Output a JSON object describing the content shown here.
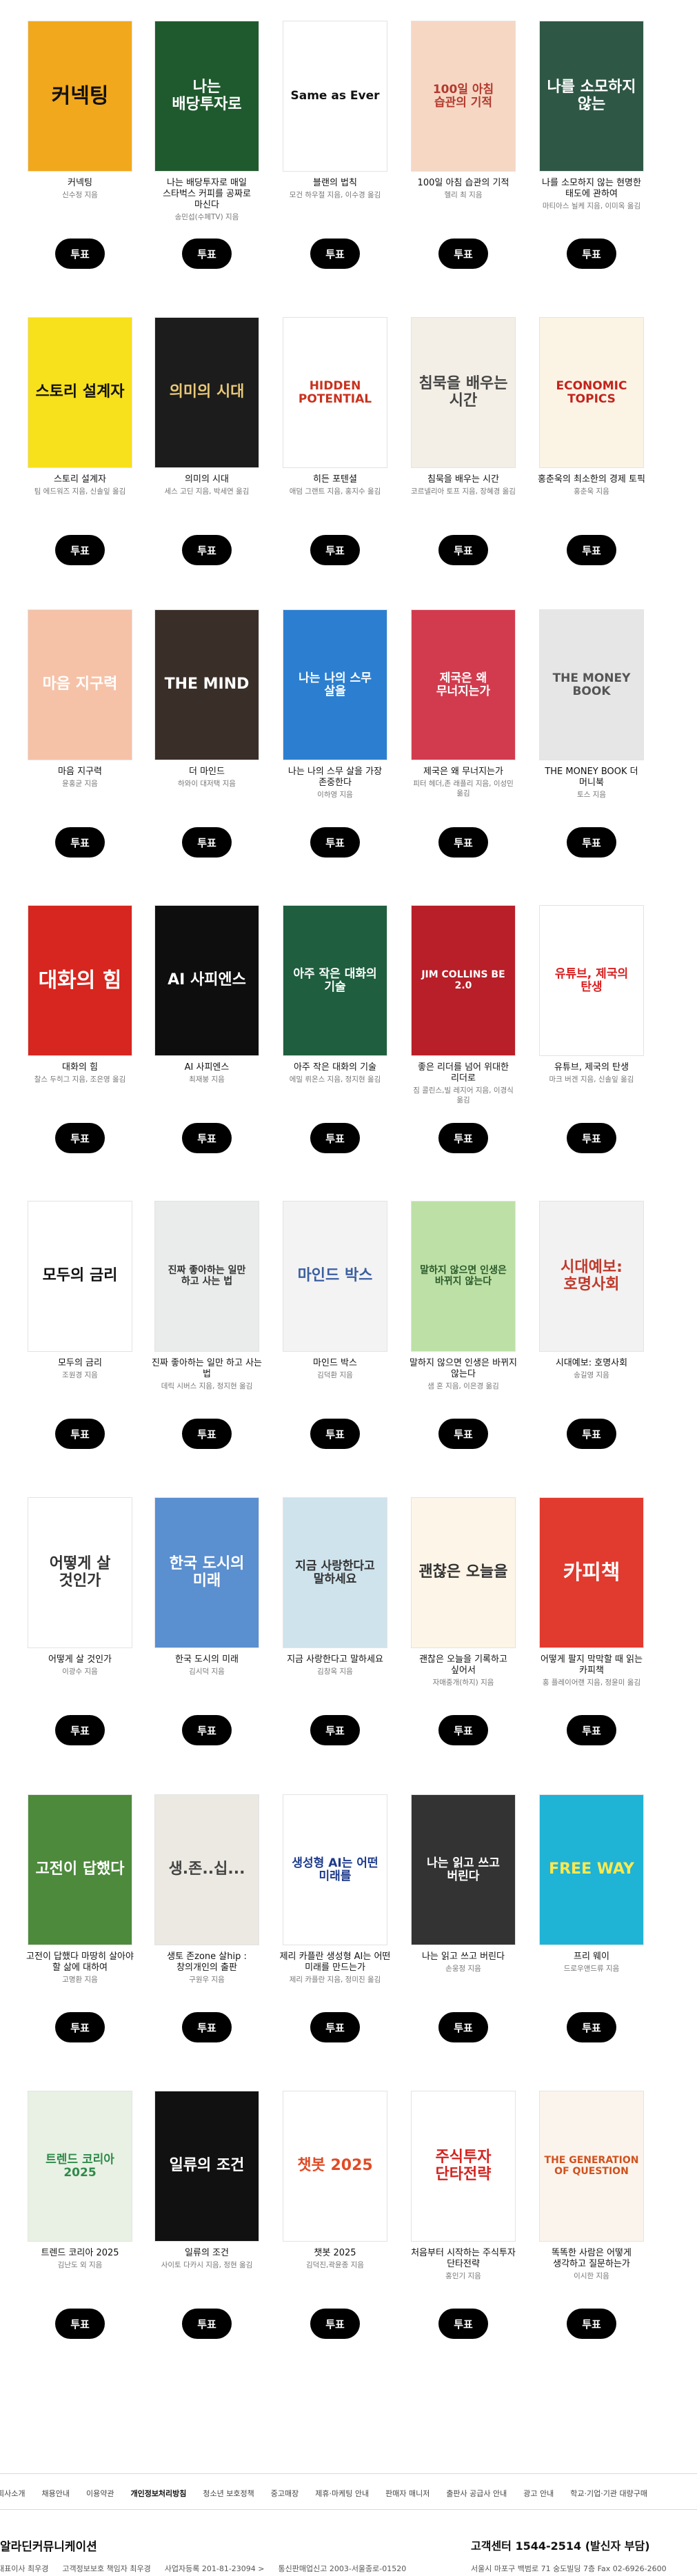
{
  "vote_label": "투표",
  "books": [
    {
      "title": "커넥팅",
      "author": "신수정 지음",
      "cover_bg": "#f2a81c",
      "cover_fg": "#111111",
      "cover_text": "커넥팅"
    },
    {
      "title": "나는 배당투자로 매일 스타벅스 커피를 공짜로 마신다",
      "author": "송민섭(수페TV) 지음",
      "cover_bg": "#1f5a2e",
      "cover_fg": "#ffffff",
      "cover_text": "나는 배당투자로"
    },
    {
      "title": "블랜의 법칙",
      "author": "모건 하우절 지음, 이수경 옮김",
      "cover_bg": "#ffffff",
      "cover_fg": "#111111",
      "cover_text": "Same as Ever"
    },
    {
      "title": "100일 아침 습관의 기적",
      "author": "헬리 최 지음",
      "cover_bg": "#f6d7c4",
      "cover_fg": "#b23a2e",
      "cover_text": "100일 아침 습관의 기적"
    },
    {
      "title": "나를 소모하지 않는 현명한 태도에 관하여",
      "author": "마티아스 뇔케 지음, 이미옥 옮김",
      "cover_bg": "#2f5746",
      "cover_fg": "#ffffff",
      "cover_text": "나를 소모하지 않는"
    },
    {
      "title": "스토리 설계자",
      "author": "팀 에드워즈 지음, 신솔잎 옮김",
      "cover_bg": "#f7e01c",
      "cover_fg": "#111111",
      "cover_text": "스토리 설계자"
    },
    {
      "title": "의미의 시대",
      "author": "세스 고딘 지음, 박세연 옮김",
      "cover_bg": "#1c1c1c",
      "cover_fg": "#e8c777",
      "cover_text": "의미의 시대"
    },
    {
      "title": "히든 포텐셜",
      "author": "애덤 그랜트 지음, 홍지수 옮김",
      "cover_bg": "#ffffff",
      "cover_fg": "#c8321e",
      "cover_text": "HIDDEN POTENTIAL"
    },
    {
      "title": "침묵을 배우는 시간",
      "author": "코르넬리아 토프 지음, 장혜경 옮김",
      "cover_bg": "#f3efe6",
      "cover_fg": "#444444",
      "cover_text": "침묵을 배우는 시간"
    },
    {
      "title": "홍춘욱의 최소한의 경제 토픽",
      "author": "홍춘욱 지음",
      "cover_bg": "#fbf4e5",
      "cover_fg": "#c3231d",
      "cover_text": "ECONOMIC TOPICS"
    },
    {
      "title": "마음 지구력",
      "author": "윤홍균 지음",
      "cover_bg": "#f5c2a8",
      "cover_fg": "#ffffff",
      "cover_text": "마음 지구력"
    },
    {
      "title": "더 마인드",
      "author": "하와이 대저택 지음",
      "cover_bg": "#3a2e28",
      "cover_fg": "#ffffff",
      "cover_text": "THE MIND"
    },
    {
      "title": "나는 나의 스무 살을 가장 존중한다",
      "author": "이하영 지음",
      "cover_bg": "#2c7fd0",
      "cover_fg": "#ffffff",
      "cover_text": "나는 나의 스무 살을"
    },
    {
      "title": "제국은 왜 무너지는가",
      "author": "피터 헤더,존 래플리 지음, 이성민 옮김",
      "cover_bg": "#d23b4e",
      "cover_fg": "#ffffff",
      "cover_text": "제국은 왜 무너지는가"
    },
    {
      "title": "THE MONEY BOOK 더 머니북",
      "author": "토스 지음",
      "cover_bg": "#e6e6e6",
      "cover_fg": "#555555",
      "cover_text": "THE MONEY BOOK"
    },
    {
      "title": "대화의 힘",
      "author": "찰스 두히그 지음, 조은영 옮김",
      "cover_bg": "#d6261f",
      "cover_fg": "#ffffff",
      "cover_text": "대화의 힘"
    },
    {
      "title": "AI 사피엔스",
      "author": "최재붕 지음",
      "cover_bg": "#0e0e0e",
      "cover_fg": "#ffffff",
      "cover_text": "AI 사피엔스"
    },
    {
      "title": "아주 작은 대화의 기술",
      "author": "에밀 뤼온스 지음, 정지현 옮김",
      "cover_bg": "#1f5e3e",
      "cover_fg": "#ffffff",
      "cover_text": "아주 작은 대화의 기술"
    },
    {
      "title": "좋은 리더를 넘어 위대한 리더로",
      "author": "짐 콜린스,빌 레지어 지음, 이경식 옮김",
      "cover_bg": "#b81f28",
      "cover_fg": "#ffffff",
      "cover_text": "JIM COLLINS BE 2.0"
    },
    {
      "title": "유튜브, 제국의 탄생",
      "author": "마크 버겐 지음, 신솔잎 옮김",
      "cover_bg": "#ffffff",
      "cover_fg": "#d81f1f",
      "cover_text": "유튜브, 제국의 탄생"
    },
    {
      "title": "모두의 금리",
      "author": "조원경 지음",
      "cover_bg": "#ffffff",
      "cover_fg": "#111111",
      "cover_text": "모두의 금리"
    },
    {
      "title": "진짜 좋아하는 일만 하고 사는 법",
      "author": "데릭 시버스 지음, 정지현 옮김",
      "cover_bg": "#e9ecea",
      "cover_fg": "#333333",
      "cover_text": "진짜 좋아하는 일만 하고 사는 법"
    },
    {
      "title": "마인드 박스",
      "author": "김덕환 지음",
      "cover_bg": "#f3f3f3",
      "cover_fg": "#3b5fa0",
      "cover_text": "마인드 박스"
    },
    {
      "title": "말하지 않으면 인생은 바뀌지 않는다",
      "author": "샘 혼 지음, 이은경 옮김",
      "cover_bg": "#bde0a6",
      "cover_fg": "#2a5a2a",
      "cover_text": "말하지 않으면 인생은 바뀌지 않는다"
    },
    {
      "title": "시대예보: 호명사회",
      "author": "송길영 지음",
      "cover_bg": "#f2f2f2",
      "cover_fg": "#c0392b",
      "cover_text": "시대예보: 호명사회"
    },
    {
      "title": "어떻게 살 것인가",
      "author": "이광수 지음",
      "cover_bg": "#ffffff",
      "cover_fg": "#333333",
      "cover_text": "어떻게 살 것인가"
    },
    {
      "title": "한국 도시의 미래",
      "author": "김시덕 지음",
      "cover_bg": "#5a8fd0",
      "cover_fg": "#ffffff",
      "cover_text": "한국 도시의 미래"
    },
    {
      "title": "지금 사랑한다고 말하세요",
      "author": "김창옥 지음",
      "cover_bg": "#cfe3ec",
      "cover_fg": "#333333",
      "cover_text": "지금 사랑한다고 말하세요"
    },
    {
      "title": "괜찮은 오늘을 기록하고 싶어서",
      "author": "자매중개(하지) 지음",
      "cover_bg": "#fdf5e7",
      "cover_fg": "#333333",
      "cover_text": "괜찮은 오늘을"
    },
    {
      "title": "어떻게 팔지 막막할 때 읽는 카피책",
      "author": "홍 플레이어랜 지음, 정윤미 옮김",
      "cover_bg": "#e13a2f",
      "cover_fg": "#ffffff",
      "cover_text": "카피책"
    },
    {
      "title": "고전이 답했다 마땅히 살아야 할 삶에 대하여",
      "author": "고명환 지음",
      "cover_bg": "#4d8a3c",
      "cover_fg": "#ffffff",
      "cover_text": "고전이 답했다"
    },
    {
      "title": "생토 존zone 살hip : 창의개인의 출판",
      "author": "구원우 지음",
      "cover_bg": "#ece9e2",
      "cover_fg": "#444444",
      "cover_text": "생.존..십..."
    },
    {
      "title": "제리 카플란 생성형 AI는 어떤 미래를 만드는가",
      "author": "제리 카플란 지음, 정미진 옮김",
      "cover_bg": "#ffffff",
      "cover_fg": "#1d3b8a",
      "cover_text": "생성형 AI는 어떤 미래를"
    },
    {
      "title": "나는 읽고 쓰고 버린다",
      "author": "손웅정 지음",
      "cover_bg": "#333333",
      "cover_fg": "#ffffff",
      "cover_text": "나는 읽고 쓰고 버린다"
    },
    {
      "title": "프리 웨이",
      "author": "드로우앤드류 지음",
      "cover_bg": "#1fb3d6",
      "cover_fg": "#ffe94d",
      "cover_text": "FREE WAY"
    },
    {
      "title": "트렌드 코리아 2025",
      "author": "김난도 외 지음",
      "cover_bg": "#e8f1e4",
      "cover_fg": "#2f8a4a",
      "cover_text": "트렌드 코리아 2025"
    },
    {
      "title": "일류의 조건",
      "author": "사이토 다카시 지음, 정현 옮김",
      "cover_bg": "#111111",
      "cover_fg": "#ffffff",
      "cover_text": "일류의 조건"
    },
    {
      "title": "챗봇 2025",
      "author": "김덕진,곽윤종 지음",
      "cover_bg": "#ffffff",
      "cover_fg": "#e04b26",
      "cover_text": "챗봇 2025"
    },
    {
      "title": "처음부터 시작하는 주식투자 단타전략",
      "author": "홍인기 지음",
      "cover_bg": "#ffffff",
      "cover_fg": "#d3231f",
      "cover_text": "주식투자 단타전략"
    },
    {
      "title": "똑똑한 사람은 어떻게 생각하고 질문하는가",
      "author": "이시한 지음",
      "cover_bg": "#fbf4ec",
      "cover_fg": "#d0521f",
      "cover_text": "THE GENERATION OF QUESTION"
    }
  ],
  "footer": {
    "nav": [
      "회사소개",
      "채용안내",
      "이용약관",
      "개인정보처리방침",
      "청소년 보호정책",
      "중고매장",
      "제휴·마케팅 안내",
      "판매자 매니저",
      "출판사 공급사 안내",
      "광고 안내",
      "학교·기업·기관 대량구매"
    ],
    "company": "알라딘커뮤니케이션",
    "customer_center": "고객센터 1544-2514 (발신자 부담)",
    "info": [
      "대표이사 최우경",
      "고객정보보호 책임자 최우경",
      "사업자등록 201-81-23094 >",
      "통신판매업신고 2003-서울종로-01520"
    ],
    "address": "서울시 마포구 백범로 71 숭도빌딩 7층 Fax 02-6926-2600"
  }
}
